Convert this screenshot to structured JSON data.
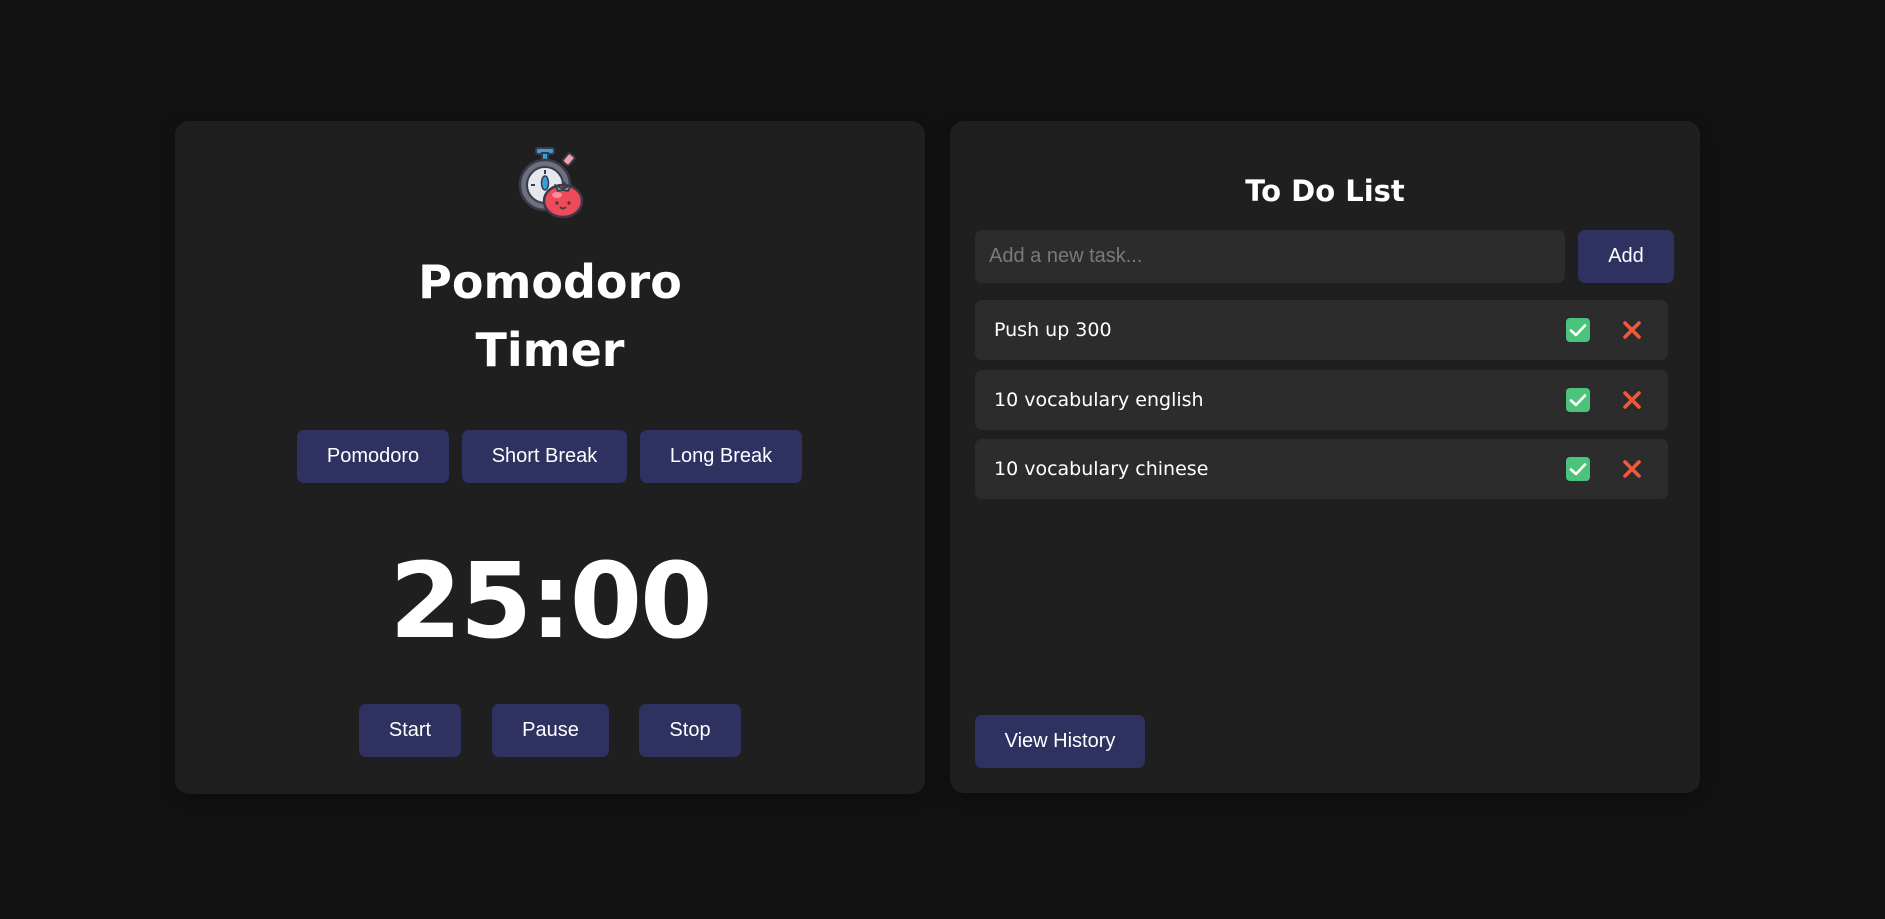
{
  "timer": {
    "title_line1": "Pomodoro",
    "title_line2": "Timer",
    "logo_icon": "stopwatch-tomato-icon",
    "modes": [
      {
        "label": "Pomodoro"
      },
      {
        "label": "Short Break"
      },
      {
        "label": "Long Break"
      }
    ],
    "time_display": "25:00",
    "controls": {
      "start_label": "Start",
      "pause_label": "Pause",
      "stop_label": "Stop"
    }
  },
  "todo": {
    "title": "To Do List",
    "input_placeholder": "Add a new task...",
    "input_value": "",
    "add_label": "Add",
    "tasks": [
      {
        "text": "Push up 300",
        "complete_icon": "check-box-icon",
        "delete_icon": "close-x-icon"
      },
      {
        "text": "10 vocabulary english",
        "complete_icon": "check-box-icon",
        "delete_icon": "close-x-icon"
      },
      {
        "text": "10 vocabulary chinese",
        "complete_icon": "check-box-icon",
        "delete_icon": "close-x-icon"
      }
    ],
    "history_label": "View History"
  },
  "colors": {
    "page_background": "#121212",
    "panel_background": "#1f1f1f",
    "button_background": "#2f3160",
    "task_background": "#2c2c2c",
    "check_green": "#4cc37a",
    "delete_red": "#f05a3c",
    "text": "#ffffff"
  }
}
